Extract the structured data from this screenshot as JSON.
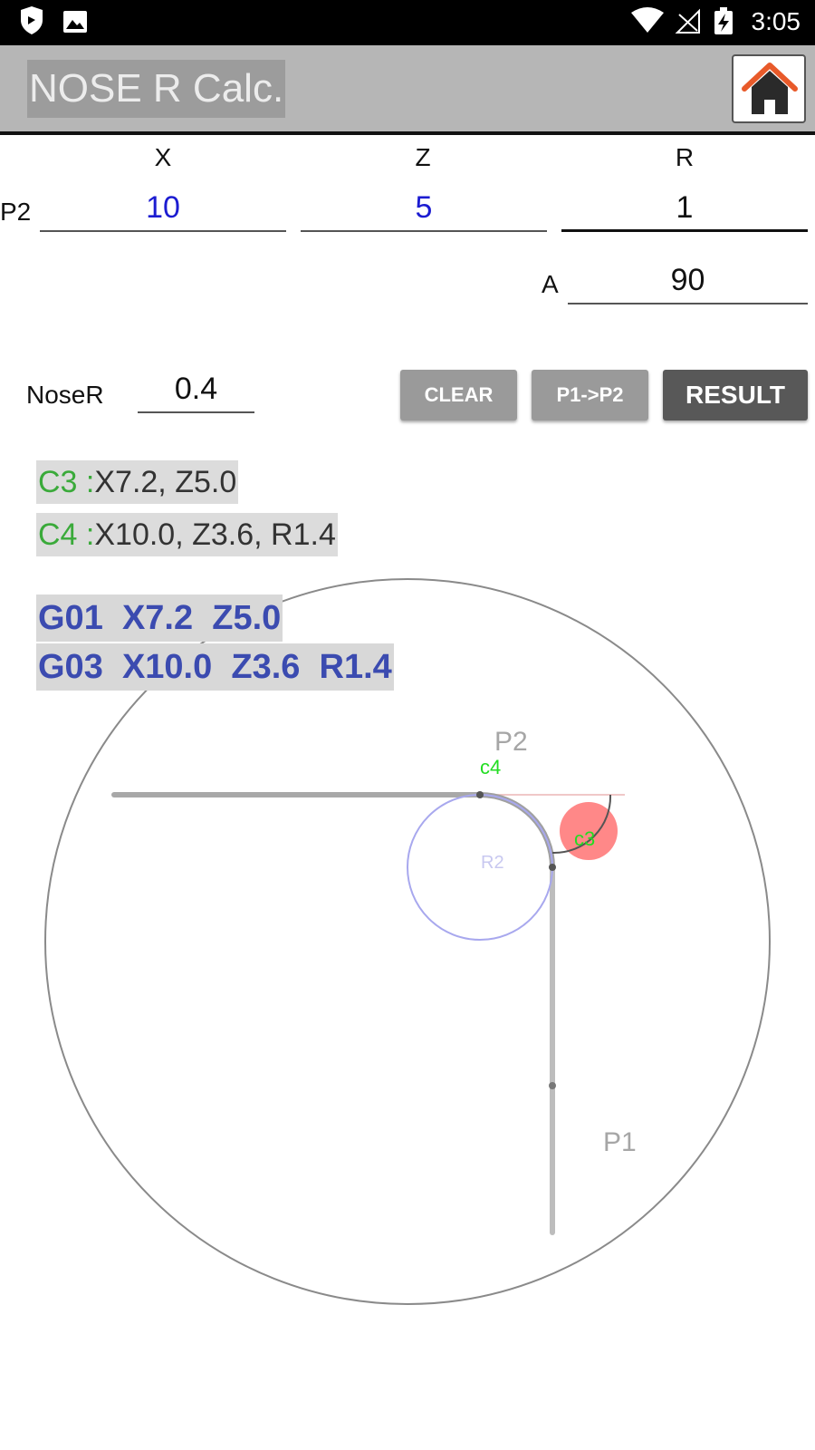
{
  "status_bar": {
    "time": "3:05",
    "left_icons": [
      "shield-icon",
      "image-icon"
    ],
    "right_icons": [
      "wifi-icon",
      "signal-off-icon",
      "battery-charging-icon"
    ]
  },
  "app_bar": {
    "title": "NOSE R Calc.",
    "home_icon": "home-icon"
  },
  "inputs": {
    "col_x": "X",
    "col_z": "Z",
    "col_r": "R",
    "row_p2": "P2",
    "p2_x": "10",
    "p2_z": "5",
    "p2_r": "1",
    "a_label": "A",
    "a_value": "90",
    "nose_r_label": "NoseR",
    "nose_r_value": "0.4"
  },
  "buttons": {
    "clear": "CLEAR",
    "p1_to_p2": "P1->P2",
    "result": "RESULT"
  },
  "results": {
    "c3_label": "C3 :",
    "c3_value": "X7.2, Z5.0",
    "c4_label": "C4 :",
    "c4_value": "X10.0, Z3.6, R1.4",
    "gcode_line1": "G01  X7.2  Z5.0",
    "gcode_line2": "G03  X10.0  Z3.6  R1.4"
  },
  "drawing": {
    "label_p2": "P2",
    "label_p1": "P1",
    "label_c4": "c4",
    "label_c3": "c3",
    "label_r2": "R2",
    "colors": {
      "outline": "#8a8a8a",
      "path": "#a8a8a8",
      "arc_circle": "#a8a8ee",
      "nose_fill": "#ff8888",
      "green_label": "#22dd22"
    }
  }
}
